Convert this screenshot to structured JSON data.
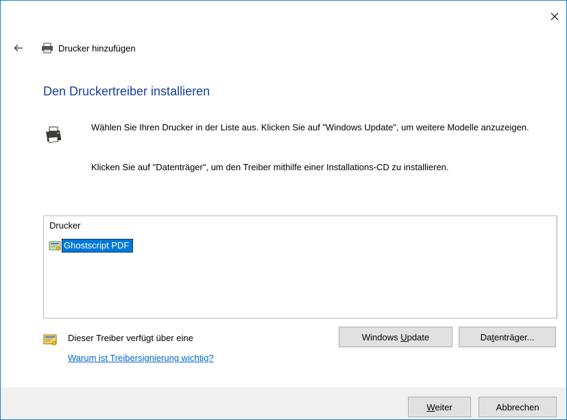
{
  "window": {
    "title": "Drucker hinzufügen"
  },
  "main": {
    "heading": "Den Druckertreiber installieren",
    "paragraph1": "Wählen Sie Ihren Drucker in der Liste aus. Klicken Sie auf \"Windows Update\", um weitere Modelle anzuzeigen.",
    "paragraph2": "Klicken Sie auf \"Datenträger\", um den Treiber mithilfe einer Installations-CD zu installieren."
  },
  "printer_list": {
    "column_header": "Drucker",
    "items": [
      {
        "label": "Ghostscript PDF",
        "selected": true
      }
    ]
  },
  "signing": {
    "text": "Dieser Treiber verfügt über eine",
    "link": "Warum ist Treibersignierung wichtig?"
  },
  "buttons": {
    "windows_update": {
      "before": "Windows ",
      "accel": "U",
      "after": "pdate"
    },
    "disk": {
      "before": "Da",
      "accel": "t",
      "after": "enträger..."
    },
    "next": {
      "before": "",
      "accel": "W",
      "after": "eiter"
    },
    "cancel": "Abbrechen"
  },
  "icons": {
    "close": "close-icon",
    "back": "back-arrow-icon",
    "printer": "printer-icon",
    "driver": "driver-certificate-icon"
  },
  "colors": {
    "heading": "#1a3fa0",
    "selection": "#0078d7",
    "link": "#0066cc",
    "window_border": "#1883d7",
    "footer": "#f0f0f0"
  }
}
